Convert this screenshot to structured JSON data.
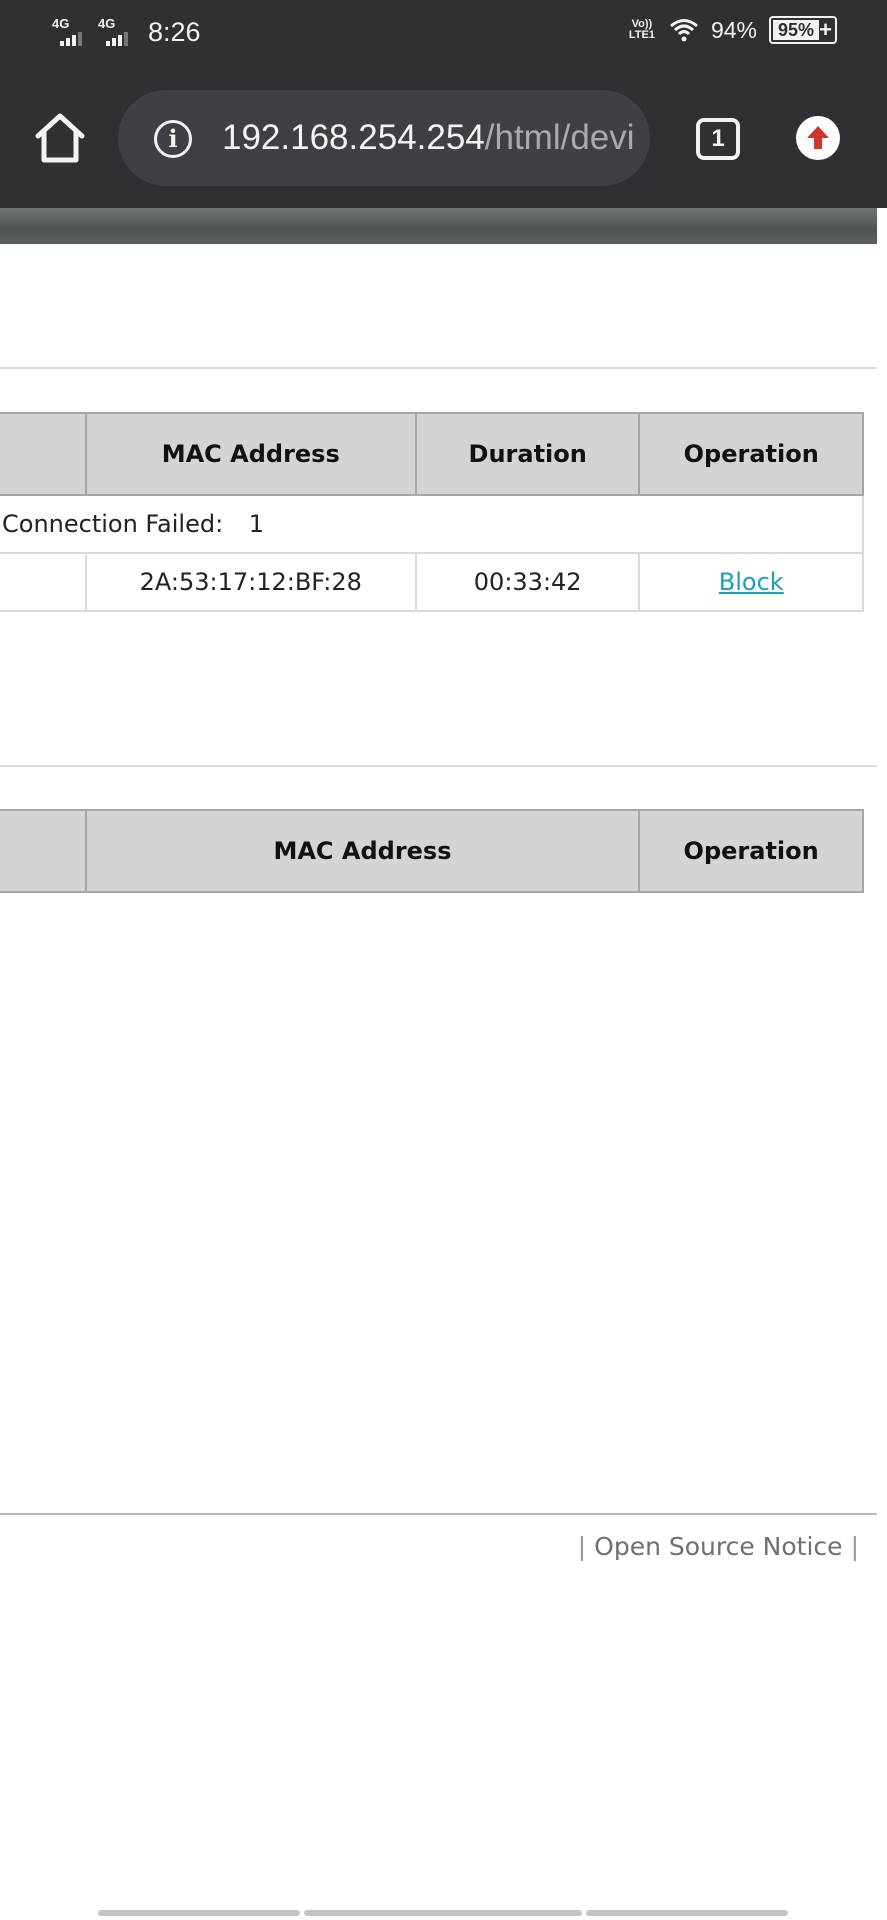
{
  "status_bar": {
    "network_1": "4G",
    "network_2": "4G",
    "time": "8:26",
    "volte": "Vo))\nLTE1",
    "battery_percent": "94%",
    "battery_badge": "95%"
  },
  "browser": {
    "url_host": "192.168.254.254",
    "url_path": "/html/devi",
    "tab_count": "1"
  },
  "online_devices": {
    "columns": [
      "",
      "MAC Address",
      "Duration",
      "Operation"
    ],
    "summary_label": "Connection Failed:",
    "summary_count": "1",
    "rows": [
      {
        "name": "",
        "mac": "2A:53:17:12:BF:28",
        "duration": "00:33:42",
        "action": "Block"
      }
    ]
  },
  "blocked_devices": {
    "columns": [
      "",
      "MAC Address",
      "Operation"
    ]
  },
  "footer": {
    "separator": "|",
    "open_source_notice": "Open Source Notice"
  }
}
